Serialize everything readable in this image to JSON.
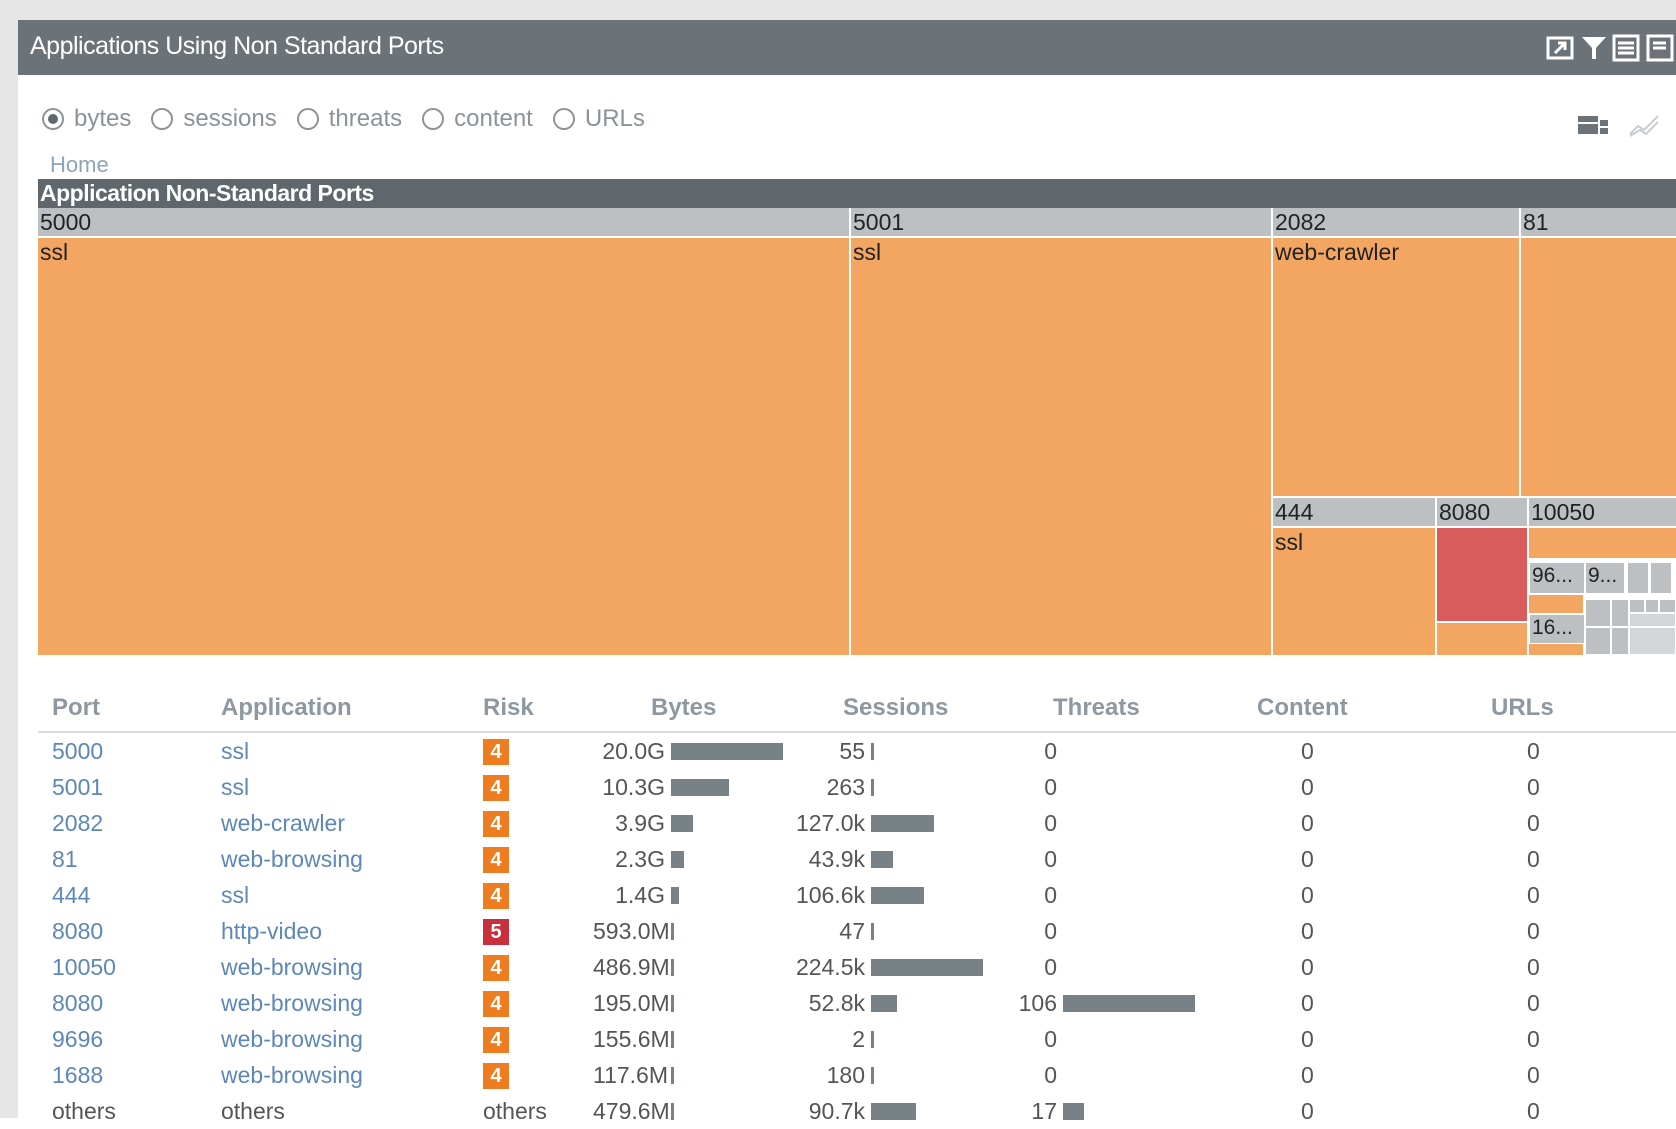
{
  "widget": {
    "title": "Applications Using Non Standard Ports",
    "toolbar_icons": [
      "popout-icon",
      "filter-icon",
      "table-view-icon",
      "export-icon"
    ]
  },
  "metric_options": [
    "bytes",
    "sessions",
    "threats",
    "content",
    "URLs"
  ],
  "selected_metric": "bytes",
  "breadcrumb": "Home",
  "treemap": {
    "title": "Application Non-Standard Ports",
    "port_labels": [
      "5000",
      "5001",
      "2082",
      "81",
      "444",
      "8080",
      "10050",
      "96...",
      "9...",
      "16..."
    ],
    "app_labels": [
      "ssl",
      "ssl",
      "web-crawler",
      "ssl"
    ],
    "colors": {
      "risk4": "#f3a562",
      "risk5": "#d85c5c",
      "port_header": "#bcc0c3"
    }
  },
  "table": {
    "columns": [
      "Port",
      "Application",
      "Risk",
      "Bytes",
      "Sessions",
      "Threats",
      "Content",
      "URLs"
    ],
    "rows": [
      {
        "port": "5000",
        "app": "ssl",
        "risk": "4",
        "bytes": "20.0G",
        "bytes_val": 20000,
        "sessions": "55",
        "sessions_val": 55,
        "threats": "0",
        "threats_val": 0,
        "content": "0",
        "urls": "0"
      },
      {
        "port": "5001",
        "app": "ssl",
        "risk": "4",
        "bytes": "10.3G",
        "bytes_val": 10300,
        "sessions": "263",
        "sessions_val": 263,
        "threats": "0",
        "threats_val": 0,
        "content": "0",
        "urls": "0"
      },
      {
        "port": "2082",
        "app": "web-crawler",
        "risk": "4",
        "bytes": "3.9G",
        "bytes_val": 3900,
        "sessions": "127.0k",
        "sessions_val": 127000,
        "threats": "0",
        "threats_val": 0,
        "content": "0",
        "urls": "0"
      },
      {
        "port": "81",
        "app": "web-browsing",
        "risk": "4",
        "bytes": "2.3G",
        "bytes_val": 2300,
        "sessions": "43.9k",
        "sessions_val": 43900,
        "threats": "0",
        "threats_val": 0,
        "content": "0",
        "urls": "0"
      },
      {
        "port": "444",
        "app": "ssl",
        "risk": "4",
        "bytes": "1.4G",
        "bytes_val": 1400,
        "sessions": "106.6k",
        "sessions_val": 106600,
        "threats": "0",
        "threats_val": 0,
        "content": "0",
        "urls": "0"
      },
      {
        "port": "8080",
        "app": "http-video",
        "risk": "5",
        "bytes": "593.0M",
        "bytes_val": 593,
        "sessions": "47",
        "sessions_val": 47,
        "threats": "0",
        "threats_val": 0,
        "content": "0",
        "urls": "0"
      },
      {
        "port": "10050",
        "app": "web-browsing",
        "risk": "4",
        "bytes": "486.9M",
        "bytes_val": 486.9,
        "sessions": "224.5k",
        "sessions_val": 224500,
        "threats": "0",
        "threats_val": 0,
        "content": "0",
        "urls": "0"
      },
      {
        "port": "8080",
        "app": "web-browsing",
        "risk": "4",
        "bytes": "195.0M",
        "bytes_val": 195,
        "sessions": "52.8k",
        "sessions_val": 52800,
        "threats": "106",
        "threats_val": 106,
        "content": "0",
        "urls": "0"
      },
      {
        "port": "9696",
        "app": "web-browsing",
        "risk": "4",
        "bytes": "155.6M",
        "bytes_val": 155.6,
        "sessions": "2",
        "sessions_val": 2,
        "threats": "0",
        "threats_val": 0,
        "content": "0",
        "urls": "0"
      },
      {
        "port": "1688",
        "app": "web-browsing",
        "risk": "4",
        "bytes": "117.6M",
        "bytes_val": 117.6,
        "sessions": "180",
        "sessions_val": 180,
        "threats": "0",
        "threats_val": 0,
        "content": "0",
        "urls": "0"
      },
      {
        "port": "others",
        "app": "others",
        "risk": "others",
        "bytes": "479.6M",
        "bytes_val": 479.6,
        "sessions": "90.7k",
        "sessions_val": 90700,
        "threats": "17",
        "threats_val": 17,
        "content": "0",
        "urls": "0"
      }
    ]
  },
  "risk_colors": {
    "4": "#ee7d22",
    "5": "#c8303b"
  }
}
